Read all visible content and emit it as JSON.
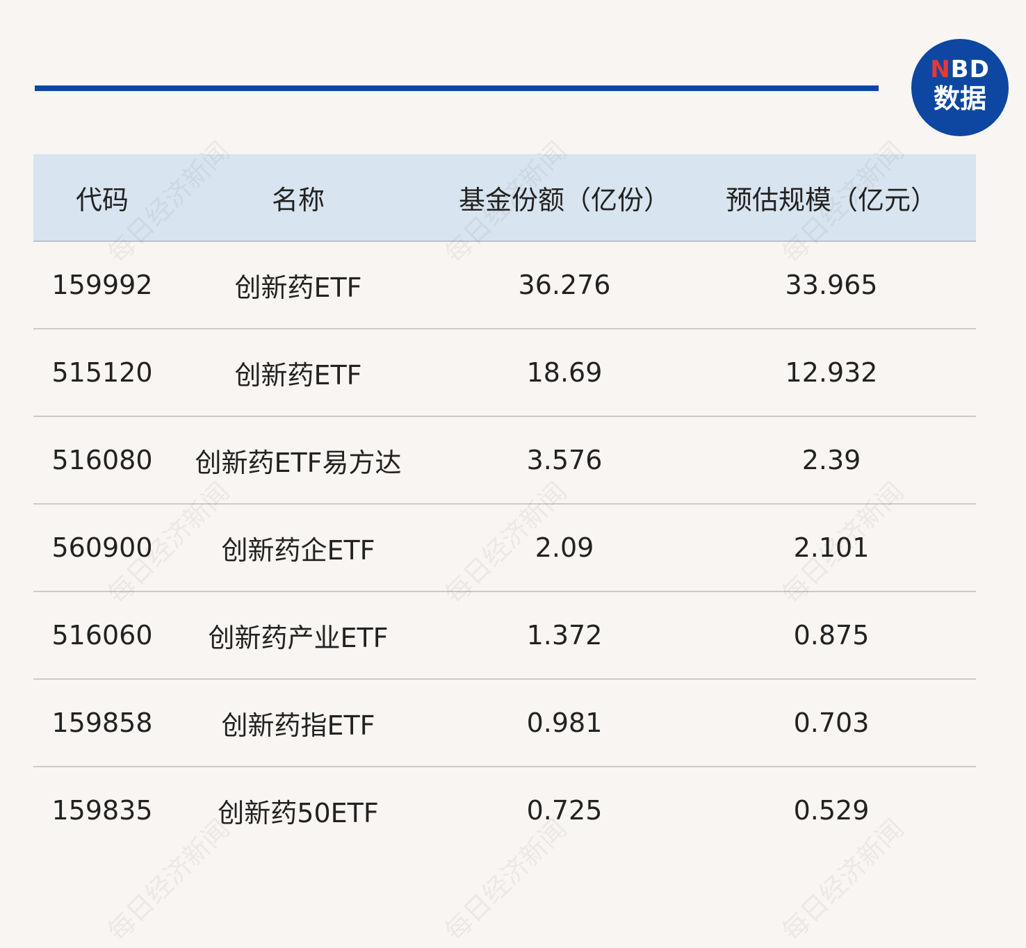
{
  "logo": {
    "line1_n": "N",
    "line1_rest": "BD",
    "line2": "数据"
  },
  "watermark_text": "每日经济新闻",
  "table": {
    "headers": [
      "代码",
      "名称",
      "基金份额（亿份）",
      "预估规模（亿元）"
    ],
    "rows": [
      [
        "159992",
        "创新药ETF",
        "36.276",
        "33.965"
      ],
      [
        "515120",
        "创新药ETF",
        "18.69",
        "12.932"
      ],
      [
        "516080",
        "创新药ETF易方达",
        "3.576",
        "2.39"
      ],
      [
        "560900",
        "创新药企ETF",
        "2.09",
        "2.101"
      ],
      [
        "516060",
        "创新药产业ETF",
        "1.372",
        "0.875"
      ],
      [
        "159858",
        "创新药指ETF",
        "0.981",
        "0.703"
      ],
      [
        "159835",
        "创新药50ETF",
        "0.725",
        "0.529"
      ]
    ]
  },
  "colors": {
    "accent": "#0d47a1",
    "logo_red": "#e53935",
    "header_bg": "#d8e4ef",
    "page_bg": "#f8f5f2"
  }
}
